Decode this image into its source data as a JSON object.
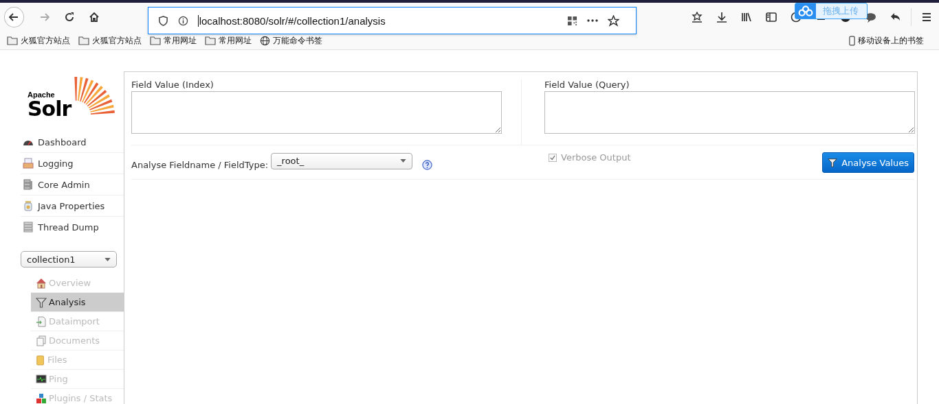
{
  "browser": {
    "url": "localhost:8080/solr/#/collection1/analysis",
    "bookmarks": [
      {
        "kind": "folder",
        "label": "火狐官方站点"
      },
      {
        "kind": "folder",
        "label": "火狐官方站点"
      },
      {
        "kind": "folder",
        "label": "常用网址"
      },
      {
        "kind": "folder",
        "label": "常用网址"
      },
      {
        "kind": "globe",
        "label": "万能命令书签"
      }
    ],
    "mobile_bookmarks": "移动设备上的书签",
    "upload_badge": "拖拽上传"
  },
  "logo": {
    "small": "Apache",
    "big": "Solr"
  },
  "menu": [
    {
      "label": "Dashboard"
    },
    {
      "label": "Logging"
    },
    {
      "label": "Core Admin"
    },
    {
      "label": "Java Properties"
    },
    {
      "label": "Thread Dump"
    }
  ],
  "core_selector": {
    "value": "collection1"
  },
  "core_menu": [
    {
      "label": "Overview",
      "selected": false,
      "disabled": true
    },
    {
      "label": "Analysis",
      "selected": true,
      "disabled": false
    },
    {
      "label": "Dataimport",
      "selected": false,
      "disabled": true
    },
    {
      "label": "Documents",
      "selected": false,
      "disabled": true
    },
    {
      "label": "Files",
      "selected": false,
      "disabled": true
    },
    {
      "label": "Ping",
      "selected": false,
      "disabled": true
    },
    {
      "label": "Plugins / Stats",
      "selected": false,
      "disabled": true
    }
  ],
  "analysis": {
    "index_label": "Field Value (Index)",
    "query_label": "Field Value (Query)",
    "fieldtype_label": "Analyse Fieldname / FieldType:",
    "fieldtype_value": "_root_",
    "verbose": {
      "label": "Verbose Output",
      "checked": true
    },
    "button": "Analyse Values"
  }
}
